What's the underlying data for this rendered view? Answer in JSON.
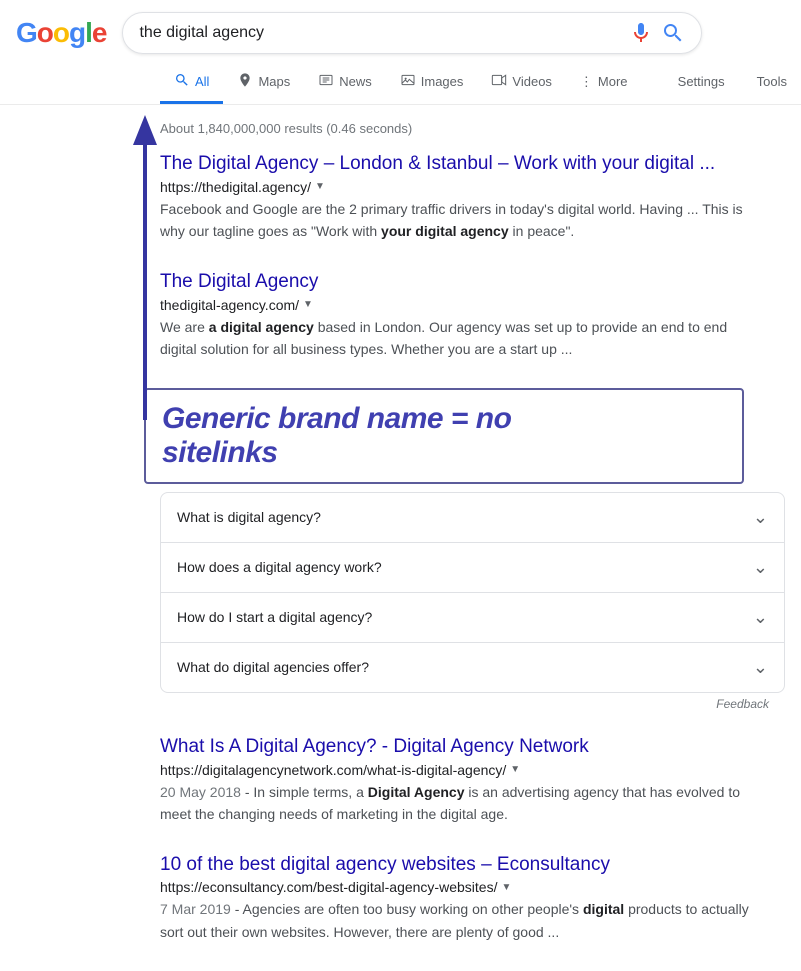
{
  "logo": {
    "letters": [
      "G",
      "o",
      "o",
      "g",
      "l",
      "e"
    ]
  },
  "search": {
    "query": "the digital agency",
    "placeholder": "Search"
  },
  "nav": {
    "tabs": [
      {
        "id": "all",
        "label": "All",
        "icon": "search-icon",
        "active": true
      },
      {
        "id": "maps",
        "label": "Maps",
        "icon": "maps-icon",
        "active": false
      },
      {
        "id": "news",
        "label": "News",
        "icon": "news-icon",
        "active": false
      },
      {
        "id": "images",
        "label": "Images",
        "icon": "images-icon",
        "active": false
      },
      {
        "id": "videos",
        "label": "Videos",
        "icon": "videos-icon",
        "active": false
      },
      {
        "id": "more",
        "label": "More",
        "icon": "more-icon",
        "active": false
      }
    ],
    "right_tabs": [
      {
        "id": "settings",
        "label": "Settings"
      },
      {
        "id": "tools",
        "label": "Tools"
      }
    ]
  },
  "results_count": "About 1,840,000,000 results (0.46 seconds)",
  "results": [
    {
      "id": "result-1",
      "title": "The Digital Agency – London & Istanbul – Work with your digital ...",
      "url": "https://thedigital.agency/",
      "snippet": "Facebook and Google are the 2 primary traffic drivers in today's digital world. Having ... This is why our tagline goes as \"Work with your digital agency in peace\".",
      "snippet_bold": [
        "your digital agency"
      ]
    },
    {
      "id": "result-2",
      "title": "The Digital Agency",
      "url": "thedigital-agency.com/",
      "snippet": "We are a digital agency based in London. Our agency was set up to provide an end to end digital solution for all business types. Whether you are a start up ...",
      "snippet_bold": [
        "a digital agency"
      ]
    }
  ],
  "annotation": {
    "text": "Generic brand name = no sitelinks"
  },
  "faq": {
    "items": [
      {
        "question": "What is digital agency?"
      },
      {
        "question": "How does a digital agency work?"
      },
      {
        "question": "How do I start a digital agency?"
      },
      {
        "question": "What do digital agencies offer?"
      }
    ],
    "feedback_label": "Feedback"
  },
  "more_results": [
    {
      "id": "result-3",
      "title": "What Is A Digital Agency? - Digital Agency Network",
      "url": "https://digitalagencynetwork.com/what-is-digital-agency/",
      "date": "20 May 2018",
      "snippet": "In simple terms, a Digital Agency is an advertising agency that has evolved to meet the changing needs of marketing in the digital age.",
      "snippet_bold": [
        "Digital Agency"
      ]
    },
    {
      "id": "result-4",
      "title": "10 of the best digital agency websites – Econsultancy",
      "url": "https://econsultancy.com/best-digital-agency-websites/",
      "date": "7 Mar 2019",
      "snippet": "Agencies are often too busy working on other people's digital products to actually sort out their own websites. However, there are plenty of good ...",
      "snippet_bold": [
        "digital"
      ]
    }
  ]
}
